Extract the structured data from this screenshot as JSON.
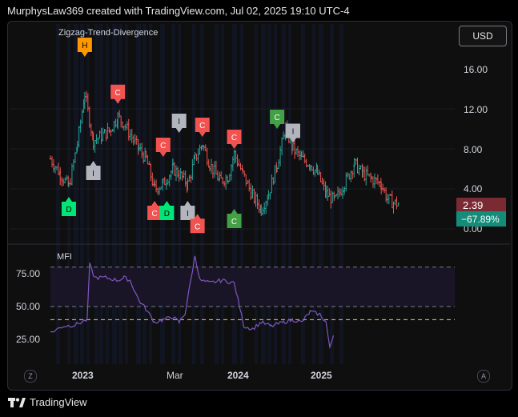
{
  "header": {
    "caption": "MurphysLaw369 created with TradingView.com, Jul 02, 2025 19:10 UTC-4"
  },
  "toolbar": {
    "currency": "USD"
  },
  "price_badges": {
    "last_price": "2.39",
    "change_pct": "−67.89%"
  },
  "footer": {
    "brand": "TradingView"
  },
  "corners": {
    "left": "Z",
    "right": "A"
  },
  "colors": {
    "up": "#26a69a",
    "down": "#ef5350",
    "mfi": "#7e57c2",
    "marker_c_red": "#f05350",
    "marker_c_green": "#43a047",
    "marker_d": "#00e676",
    "marker_i": "#b2b5be",
    "marker_h": "#ff9800"
  },
  "chart_data": [
    {
      "type": "candlestick",
      "title": "",
      "indicator": "Zigzag-Trend-Divergence",
      "y_ticks": [
        "16.00",
        "12.00",
        "8.00",
        "4.00",
        "0.00"
      ],
      "ylim": [
        0,
        19
      ],
      "x_ticks": [
        "2023",
        "Mar",
        "2024",
        "2025"
      ],
      "series": [
        {
          "values": [
            [
              0,
              7.0
            ],
            [
              8,
              5.5
            ],
            [
              15,
              4.2
            ],
            [
              22,
              8.5
            ],
            [
              28,
              13.5
            ],
            [
              35,
              8.8
            ],
            [
              48,
              9.8
            ],
            [
              55,
              11.2
            ],
            [
              60,
              10.5
            ],
            [
              72,
              8.0
            ],
            [
              78,
              7.0
            ],
            [
              85,
              4.0
            ],
            [
              92,
              4.5
            ],
            [
              100,
              6.0
            ],
            [
              105,
              5.5
            ],
            [
              112,
              4.5
            ],
            [
              118,
              7.0
            ],
            [
              124,
              8.5
            ],
            [
              130,
              6.5
            ],
            [
              138,
              4.8
            ],
            [
              145,
              5.2
            ],
            [
              150,
              7.5
            ],
            [
              157,
              5.5
            ],
            [
              165,
              3.3
            ],
            [
              172,
              2.0
            ],
            [
              178,
              3.5
            ],
            [
              185,
              6.5
            ],
            [
              192,
              10.0
            ],
            [
              198,
              8.0
            ],
            [
              205,
              7.0
            ],
            [
              212,
              6.5
            ],
            [
              218,
              5.5
            ],
            [
              225,
              3.5
            ],
            [
              232,
              2.8
            ],
            [
              240,
              4.5
            ],
            [
              248,
              6.5
            ],
            [
              255,
              5.5
            ],
            [
              262,
              5.0
            ],
            [
              270,
              4.5
            ],
            [
              275,
              3.0
            ],
            [
              280,
              2.6
            ],
            [
              285,
              2.5
            ]
          ]
        }
      ],
      "markers": [
        {
          "label": "H",
          "x": 28,
          "y": 17.2,
          "kind": "H"
        },
        {
          "label": "C",
          "x": 55,
          "y": 12.5,
          "kind": "C_red"
        },
        {
          "label": "C",
          "x": 150,
          "y": 8.0,
          "kind": "C_red"
        },
        {
          "label": "C",
          "x": 185,
          "y": 10.0,
          "kind": "C_green"
        },
        {
          "label": "I",
          "x": 198,
          "y": 8.6,
          "kind": "I"
        },
        {
          "label": "C",
          "x": 124,
          "y": 9.2,
          "kind": "C_red"
        },
        {
          "label": "I",
          "x": 105,
          "y": 9.6,
          "kind": "I"
        },
        {
          "label": "C",
          "x": 92,
          "y": 7.2,
          "kind": "C_red"
        },
        {
          "label": "D",
          "x": 15,
          "y": 3.2,
          "kind": "D_below"
        },
        {
          "label": "I",
          "x": 35,
          "y": 6.8,
          "kind": "I_below"
        },
        {
          "label": "C",
          "x": 85,
          "y": 2.8,
          "kind": "C_red_below"
        },
        {
          "label": "D",
          "x": 95,
          "y": 2.8,
          "kind": "D_below"
        },
        {
          "label": "I",
          "x": 112,
          "y": 2.8,
          "kind": "I_below"
        },
        {
          "label": "C",
          "x": 120,
          "y": 1.5,
          "kind": "C_red_below"
        },
        {
          "label": "C",
          "x": 150,
          "y": 2.0,
          "kind": "C_green_below"
        }
      ]
    },
    {
      "type": "line",
      "title": "",
      "indicator": "MFI",
      "y_ticks": [
        "75.00",
        "50.00",
        "25.00"
      ],
      "ylim": [
        10,
        90
      ],
      "bands": {
        "upper": 80,
        "middle": 50,
        "lower": 40
      },
      "series": [
        {
          "values": [
            [
              0,
              30
            ],
            [
              10,
              35
            ],
            [
              20,
              36
            ],
            [
              30,
              40
            ],
            [
              32,
              82
            ],
            [
              36,
              72
            ],
            [
              45,
              72
            ],
            [
              55,
              70
            ],
            [
              60,
              72
            ],
            [
              65,
              70
            ],
            [
              72,
              55
            ],
            [
              78,
              48
            ],
            [
              85,
              38
            ],
            [
              92,
              40
            ],
            [
              100,
              42
            ],
            [
              105,
              38
            ],
            [
              110,
              45
            ],
            [
              118,
              89
            ],
            [
              122,
              70
            ],
            [
              130,
              68
            ],
            [
              140,
              70
            ],
            [
              150,
              68
            ],
            [
              158,
              35
            ],
            [
              165,
              33
            ],
            [
              172,
              38
            ],
            [
              180,
              35
            ],
            [
              190,
              38
            ],
            [
              198,
              40
            ],
            [
              205,
              38
            ],
            [
              212,
              46
            ],
            [
              220,
              44
            ],
            [
              225,
              38
            ],
            [
              228,
              18
            ],
            [
              231,
              28
            ]
          ]
        }
      ]
    }
  ]
}
